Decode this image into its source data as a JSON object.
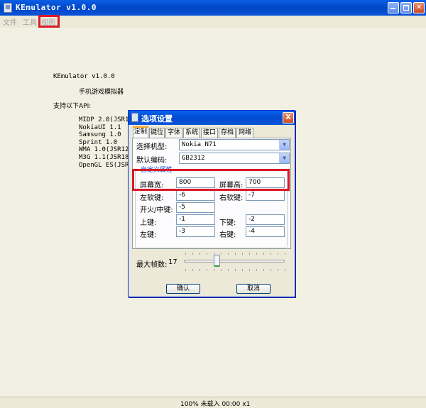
{
  "window": {
    "title": "KEmulator v1.0.0"
  },
  "menu": {
    "items": [
      "文件",
      "工具",
      "视图"
    ]
  },
  "content": {
    "line1": "KEmulator v1.0.0",
    "line2": "手机游戏模拟器",
    "line3": "支持以下API:",
    "api": [
      "MIDP 2.0(JSR118)",
      "NokiaUI 1.1",
      "Samsung 1.0",
      "Sprint 1.0",
      "WMA 1.0(JSR120)",
      "M3G 1.1(JSR184)",
      "OpenGL ES(JSR239)"
    ]
  },
  "status": {
    "text": "100% 未载入 00:00 x1"
  },
  "dialog": {
    "title": "选项设置",
    "close": "X",
    "tabs": [
      "定制",
      "键位",
      "字体",
      "系统",
      "接口",
      "存档",
      "网络"
    ],
    "model_label": "选择机型:",
    "model_value": "Nokia N71",
    "encoding_label": "默认编码:",
    "encoding_value": "GB2312",
    "group_title": "自定义属性",
    "fields": {
      "width_label": "屏幕宽:",
      "width_value": "800",
      "height_label": "屏幕高:",
      "height_value": "700",
      "lsoft_label": "左软键:",
      "lsoft_value": "-6",
      "rsoft_label": "右软键:",
      "rsoft_value": "-7",
      "fire_label": "开火/中键:",
      "fire_value": "-5",
      "up_label": "上键:",
      "up_value": "-1",
      "down_label": "下键:",
      "down_value": "-2",
      "left_label": "左键:",
      "left_value": "-3",
      "right_label": "右键:",
      "right_value": "-4"
    },
    "fps_label": "最大帧数:",
    "fps_value": "17",
    "ok": "确认",
    "cancel": "取消"
  },
  "colors": {
    "highlight": "#d8192a",
    "titlebar": "#0a5fe6"
  }
}
